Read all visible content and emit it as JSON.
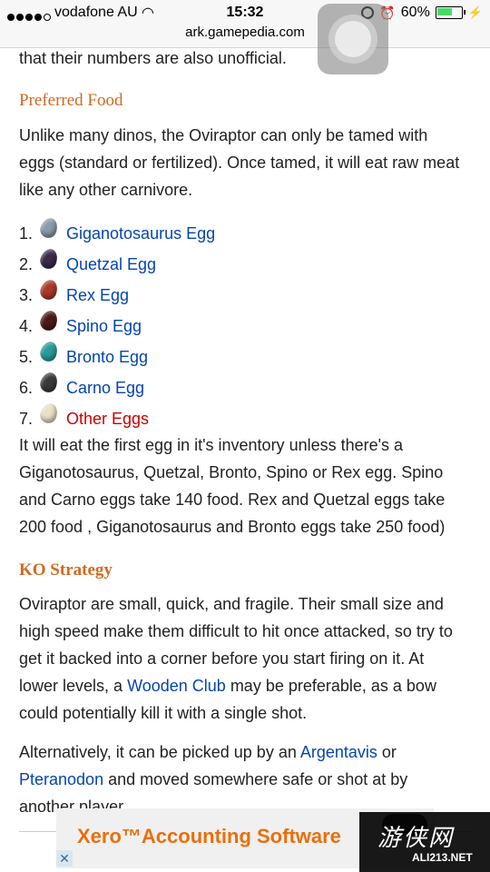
{
  "status_bar": {
    "carrier": "vodafone AU",
    "time": "15:32",
    "battery": "60%",
    "battery_level": 0.6,
    "url": "ark.gamepedia.com"
  },
  "article": {
    "top_line": "that their numbers are also unofficial.",
    "preferred_food": {
      "heading": "Preferred Food",
      "para_lines": [
        "Unlike many dinos, the Oviraptor can only be tamed with",
        "eggs (standard or fertilized). Once tamed, it will eat raw meat",
        "like any other carnivore."
      ],
      "eggs": [
        {
          "num": "1.",
          "label": "Giganotosaurus Egg",
          "color": "#8a9aa8",
          "red": false
        },
        {
          "num": "2.",
          "label": "Quetzal Egg",
          "color": "#3a2a4a",
          "red": false
        },
        {
          "num": "3.",
          "label": "Rex Egg",
          "color": "#a83a2a",
          "red": false
        },
        {
          "num": "4.",
          "label": "Spino Egg",
          "color": "#4a1a1a",
          "red": false
        },
        {
          "num": "5.",
          "label": "Bronto Egg",
          "color": "#2a9a9a",
          "red": false
        },
        {
          "num": "6.",
          "label": "Carno Egg",
          "color": "#3a3a3a",
          "red": false
        },
        {
          "num": "7.",
          "label": "Other Eggs",
          "color": "#e8e0c8",
          "red": true
        }
      ],
      "after_lines": [
        "It will eat the first egg in it's inventory unless there's a",
        "Giganotosaurus, Quetzal, Bronto, Spino or Rex egg. Spino",
        "and Carno eggs take 140 food. Rex and Quetzal eggs take",
        "200 food , Giganotosaurus and Bronto eggs take 250 food)"
      ]
    },
    "ko_strategy": {
      "heading": "KO Strategy",
      "line1": "Oviraptor are small, quick, and fragile. Their small size and",
      "line2": "high speed make them difficult to hit once attacked, so try to",
      "line3": "get it backed into a corner before you start firing on it. At",
      "line4_pre": "lower levels, a ",
      "line4_link": "Wooden Club",
      "line4_post": " may be preferable, as a bow",
      "line5": "could potentially kill it with a single shot.",
      "alt_line1_pre": "Alternatively, it can be picked up by an ",
      "alt_line1_link": "Argentavis",
      "alt_line1_post": " or",
      "alt_line2_link": "Pteranodon",
      "alt_line2_post": " and moved somewhere safe or shot at by",
      "alt_line3": "another player."
    }
  },
  "ad": {
    "text": "Xero™Accounting Software",
    "close": "✕"
  },
  "watermark": {
    "logo": "游侠网",
    "url": "ALI213.NET"
  }
}
